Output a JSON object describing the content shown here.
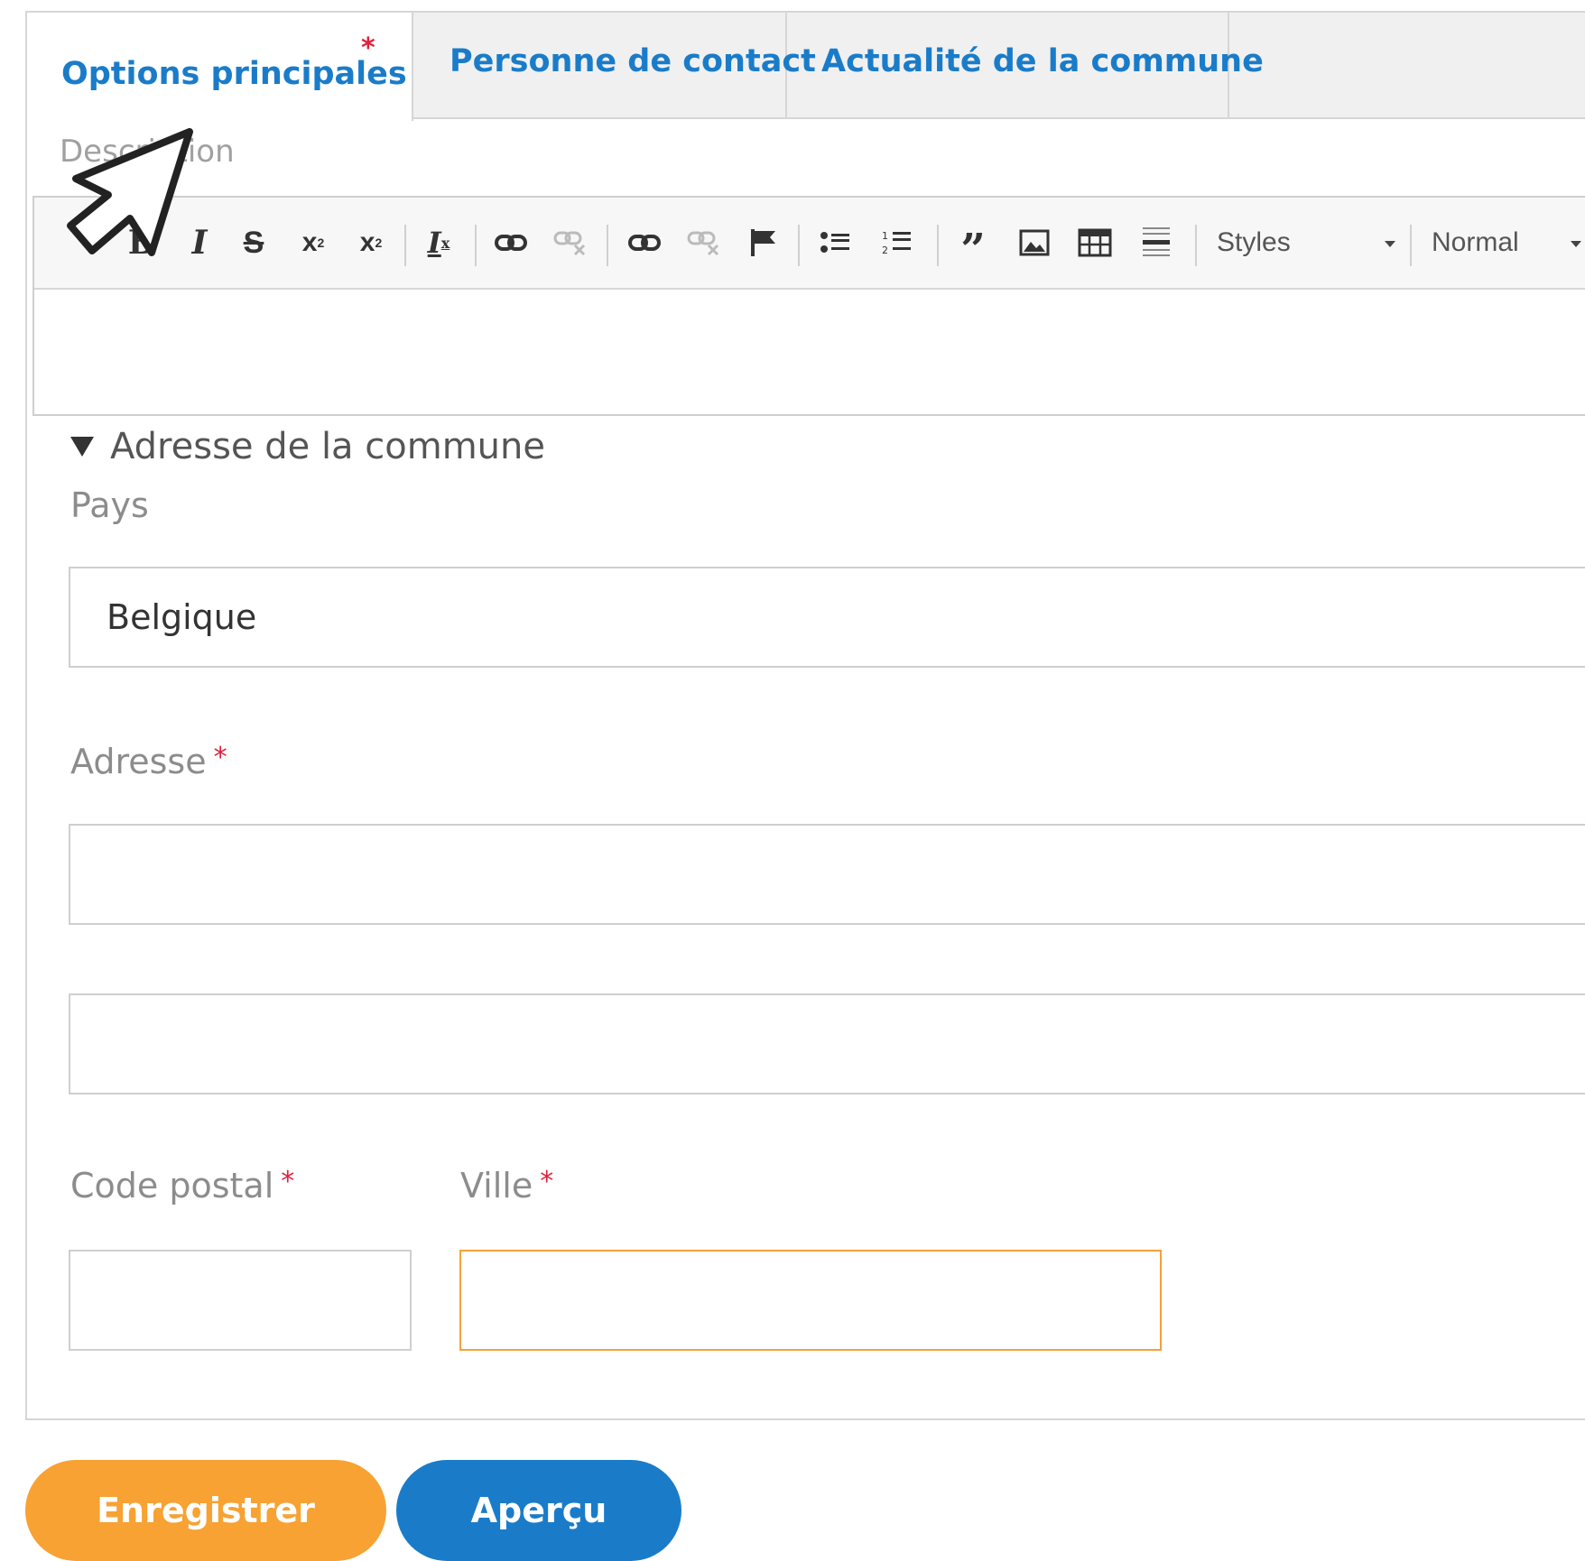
{
  "tabs": [
    {
      "label": "Options principales",
      "required_mark": "*"
    },
    {
      "label": "Personne de contact"
    },
    {
      "label": "Actualité de la commune"
    }
  ],
  "description": {
    "label": "Description"
  },
  "editor": {
    "toolbar": {
      "buttons": [
        "bold-icon",
        "italic-icon",
        "strikethrough-icon",
        "superscript-icon",
        "subscript-icon",
        "remove-format-icon",
        "link-icon",
        "unlink-icon",
        "link-icon",
        "unlink-icon",
        "anchor-flag-icon",
        "bulleted-list-icon",
        "numbered-list-icon",
        "blockquote-icon",
        "image-icon",
        "table-icon",
        "horizontal-rule-icon"
      ],
      "styles_label": "Styles",
      "format_label": "Normal"
    }
  },
  "address_section": {
    "title": "Adresse de la commune",
    "country": {
      "label": "Pays",
      "value": "Belgique"
    },
    "address": {
      "label": "Adresse",
      "required_mark": "*",
      "line1": "",
      "line2": ""
    },
    "postal_code": {
      "label": "Code postal",
      "required_mark": "*",
      "value": ""
    },
    "city": {
      "label": "Ville",
      "required_mark": "*",
      "value": ""
    }
  },
  "actions": {
    "save_label": "Enregistrer",
    "preview_label": "Aperçu"
  },
  "colors": {
    "accent_blue": "#1a7cc9",
    "accent_orange": "#f7a233",
    "required_red": "#e0203c"
  }
}
